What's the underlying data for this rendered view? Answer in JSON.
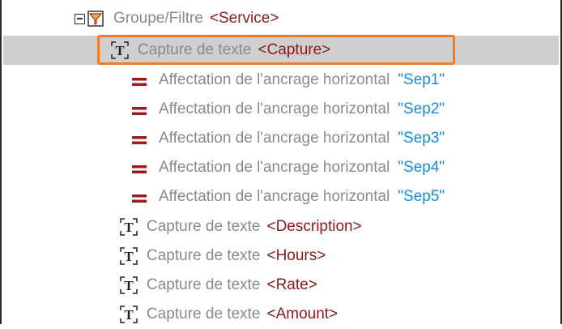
{
  "tree": {
    "group": {
      "type_label": "Groupe/Filtre",
      "target": "<Service>",
      "icons": [
        "collapse-box-icon",
        "group-filter-icon"
      ]
    },
    "items": [
      {
        "kind": "text-capture",
        "type_label": "Capture de texte",
        "target": "<Capture>",
        "selected": true,
        "icon": "text-capture-icon"
      },
      {
        "kind": "anchor",
        "type_label": "Affectation de l'ancrage horizontal",
        "value": "\"Sep1\"",
        "icon": "equals-icon"
      },
      {
        "kind": "anchor",
        "type_label": "Affectation de l'ancrage horizontal",
        "value": "\"Sep2\"",
        "icon": "equals-icon"
      },
      {
        "kind": "anchor",
        "type_label": "Affectation de l'ancrage horizontal",
        "value": "\"Sep3\"",
        "icon": "equals-icon"
      },
      {
        "kind": "anchor",
        "type_label": "Affectation de l'ancrage horizontal",
        "value": "\"Sep4\"",
        "icon": "equals-icon"
      },
      {
        "kind": "anchor",
        "type_label": "Affectation de l'ancrage horizontal",
        "value": "\"Sep5\"",
        "icon": "equals-icon"
      },
      {
        "kind": "text-capture",
        "type_label": "Capture de texte",
        "target": "<Description>",
        "icon": "text-capture-icon"
      },
      {
        "kind": "text-capture",
        "type_label": "Capture de texte",
        "target": "<Hours>",
        "icon": "text-capture-icon"
      },
      {
        "kind": "text-capture",
        "type_label": "Capture de texte",
        "target": "<Rate>",
        "icon": "text-capture-icon"
      },
      {
        "kind": "text-capture",
        "type_label": "Capture de texte",
        "target": "<Amount>",
        "icon": "text-capture-icon"
      }
    ]
  },
  "colors": {
    "type_label": "#8a8a8a",
    "target": "#8b1a1a",
    "value": "#1a8ce0",
    "selection_bg": "#cfcfcf",
    "selection_outline": "#f47b20",
    "group_icon_fill": "#f2b233",
    "group_icon_accent": "#b22222"
  }
}
